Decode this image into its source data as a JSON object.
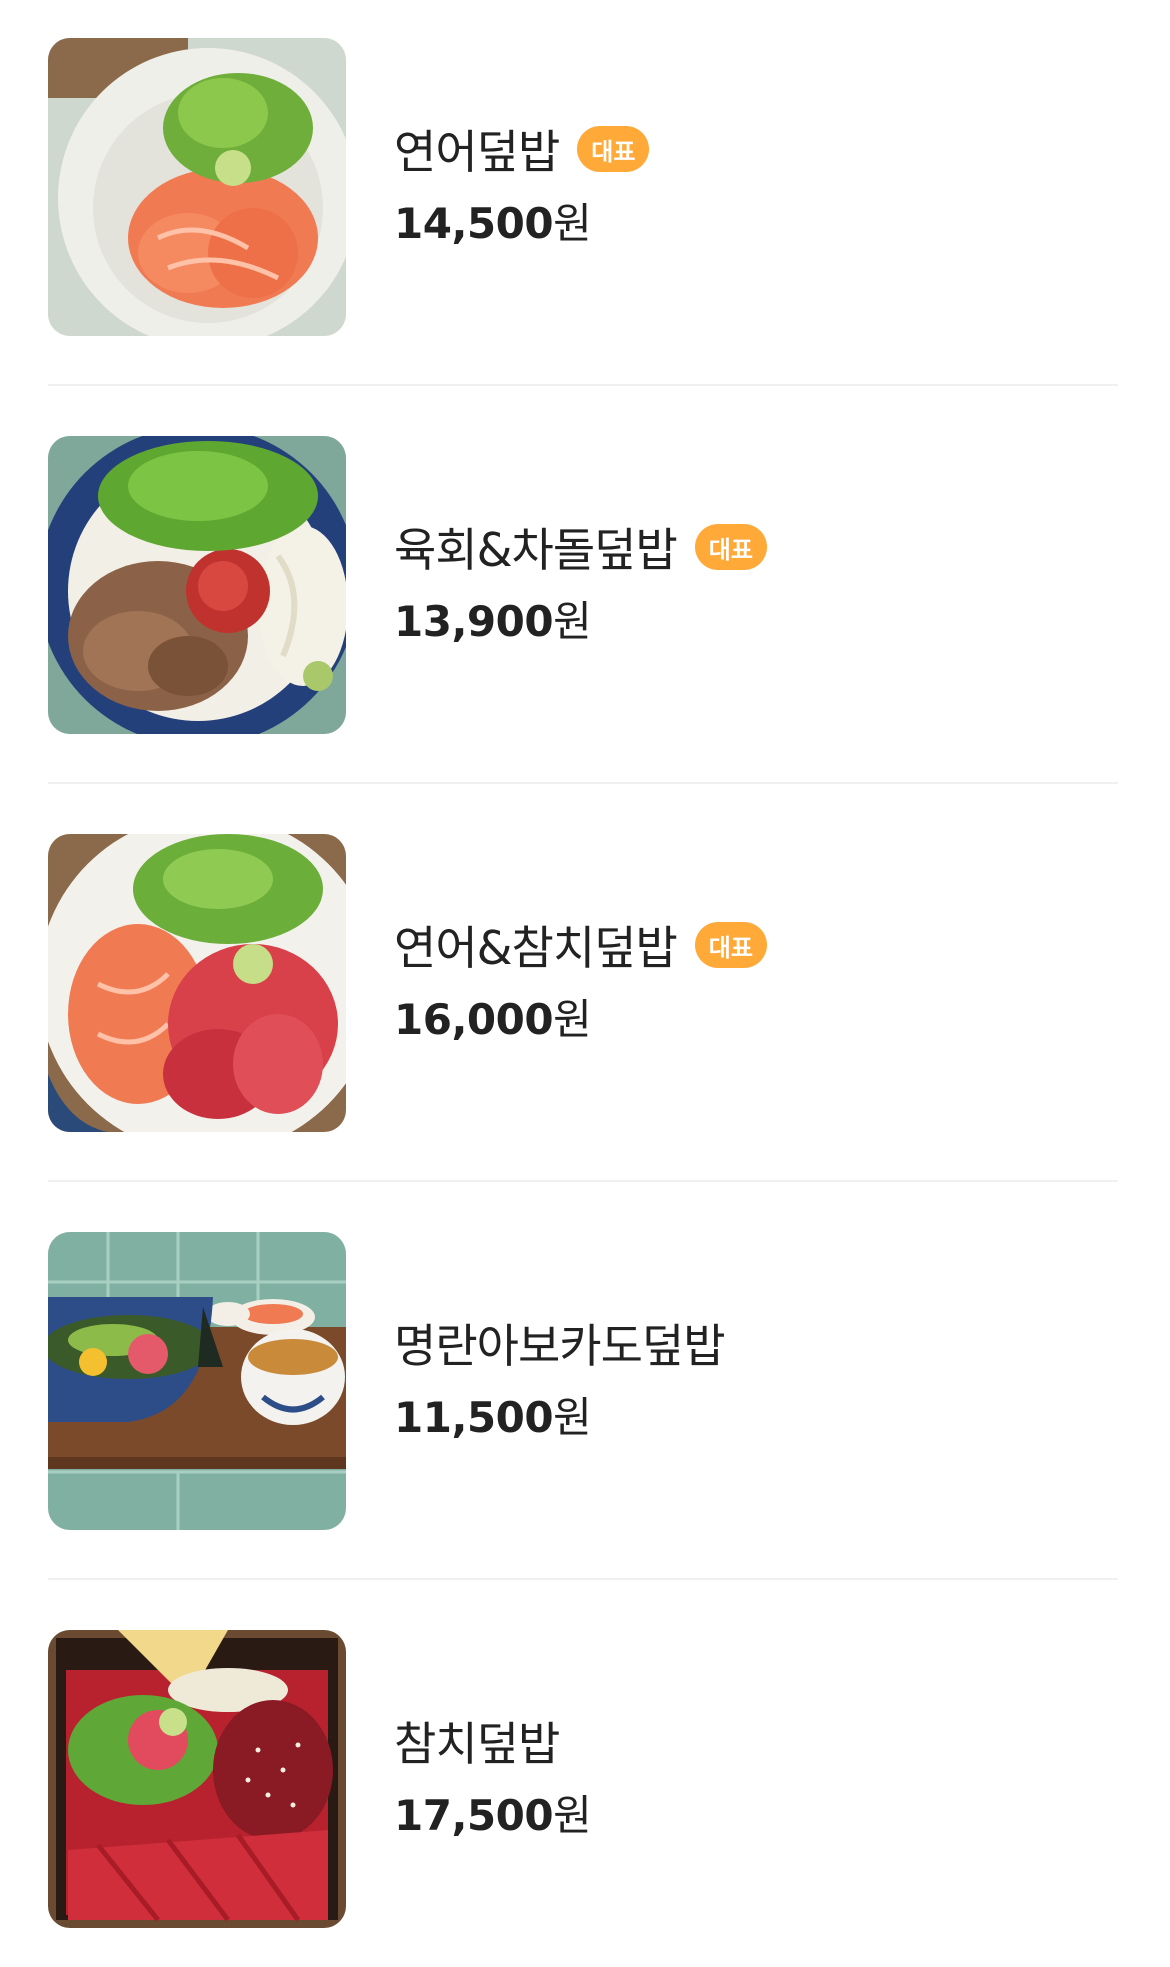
{
  "menu": {
    "items": [
      {
        "name": "연어덮밥",
        "badge": "대표",
        "price": "14,500",
        "currency": "원",
        "image": "salmon-bowl-photo"
      },
      {
        "name": "육회&차돌덮밥",
        "badge": "대표",
        "price": "13,900",
        "currency": "원",
        "image": "yukhoe-brisket-bowl-photo"
      },
      {
        "name": "연어&참치덮밥",
        "badge": "대표",
        "price": "16,000",
        "currency": "원",
        "image": "salmon-tuna-bowl-photo"
      },
      {
        "name": "명란아보카도덮밥",
        "badge": "",
        "price": "11,500",
        "currency": "원",
        "image": "mentaiko-avocado-set-photo"
      },
      {
        "name": "참치덮밥",
        "badge": "",
        "price": "17,500",
        "currency": "원",
        "image": "tuna-bowl-photo"
      }
    ]
  },
  "colors": {
    "badge_bg": "#ffa938",
    "badge_text": "#ffffff",
    "divider": "#f0f0f0",
    "text": "#222222"
  }
}
